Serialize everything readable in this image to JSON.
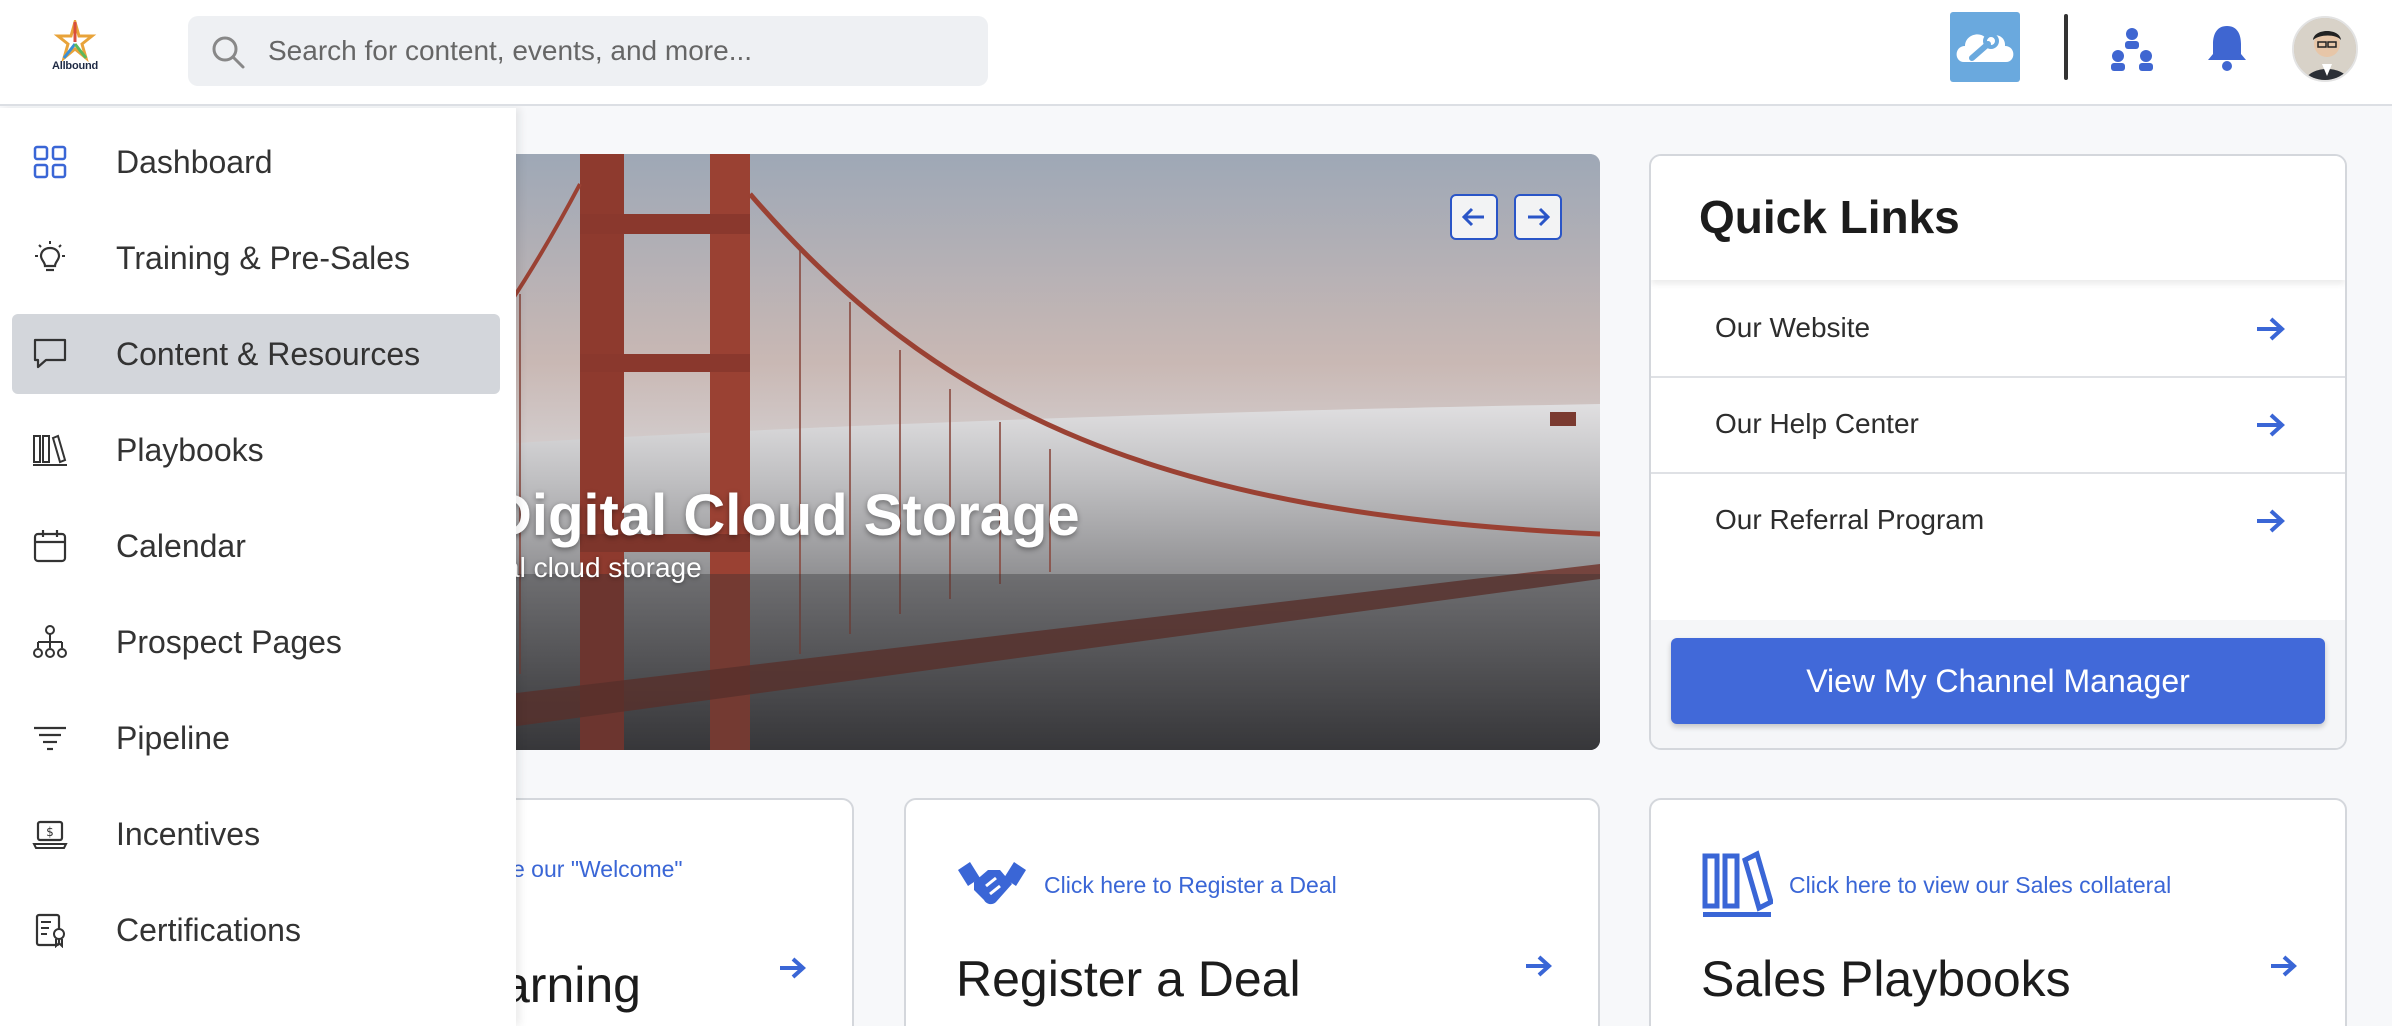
{
  "brand": {
    "logo_text": "Allbound"
  },
  "search": {
    "placeholder": "Search for content, events, and more..."
  },
  "header_icons": [
    "search-icon",
    "cloud-wrench-icon",
    "org-chart-icon",
    "bell-icon",
    "avatar"
  ],
  "sidebar": {
    "items": [
      {
        "label": "Dashboard",
        "icon": "dashboard-grid-icon",
        "active": false
      },
      {
        "label": "Training & Pre-Sales",
        "icon": "lightbulb-icon",
        "active": false
      },
      {
        "label": "Content & Resources",
        "icon": "speech-bubble-icon",
        "active": true
      },
      {
        "label": "Playbooks",
        "icon": "books-icon",
        "active": false
      },
      {
        "label": "Calendar",
        "icon": "calendar-icon",
        "active": false
      },
      {
        "label": "Prospect Pages",
        "icon": "hierarchy-icon",
        "active": false
      },
      {
        "label": "Pipeline",
        "icon": "filter-lines-icon",
        "active": false
      },
      {
        "label": "Incentives",
        "icon": "laptop-dollar-icon",
        "active": false
      },
      {
        "label": "Certifications",
        "icon": "certificate-icon",
        "active": false
      }
    ]
  },
  "hero": {
    "title": "Digital Cloud Storage",
    "subtitle": "ital cloud storage"
  },
  "quick_links": {
    "title": "Quick Links",
    "links": [
      {
        "label": "Our Website"
      },
      {
        "label": "Our Help Center"
      },
      {
        "label": "Our Referral Program"
      }
    ],
    "button_label": "View My Channel Manager"
  },
  "cards": [
    {
      "link": "e our \"Welcome\"",
      "title": "arning"
    },
    {
      "link": "Click here to Register a Deal",
      "title": "Register a Deal"
    },
    {
      "link": "Click here to view our Sales collateral",
      "title": "Sales Playbooks"
    }
  ],
  "colors": {
    "accent": "#4169d9",
    "active_nav": "#d3d6db",
    "link": "#3a66d6"
  }
}
